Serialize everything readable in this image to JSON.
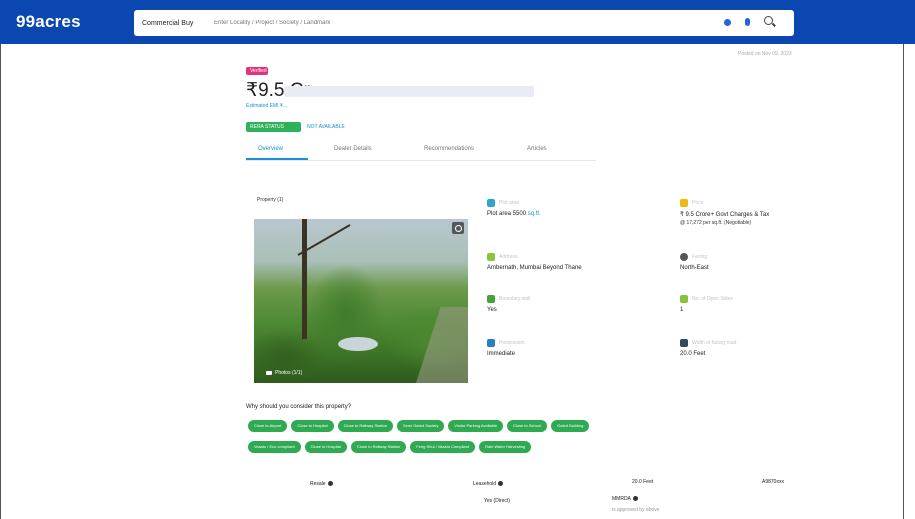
{
  "header": {
    "logo": "99acres",
    "search_category": "Commercial Buy",
    "search_placeholder": "Enter Locality / Project / Society / Landmark"
  },
  "posted": "Posted on Nov 09, 2023",
  "listing": {
    "badge": "Verified",
    "price": "₹9.5 Cr",
    "emi": "Estimated EMI ₹...",
    "rera_badge": "RERA STATUS",
    "rera_link": "NOT AVAILABLE"
  },
  "tabs": [
    "Overview",
    "Dealer Details",
    "Recommendations",
    "Articles"
  ],
  "photos": {
    "label": "Property (1)",
    "count": "Photos (1/1)"
  },
  "details": [
    {
      "icon": "area-icon",
      "color": "#2fa6c9",
      "label": "Plot area",
      "value": "Plot area 5500",
      "link": "sq.ft."
    },
    {
      "icon": "price-icon",
      "color": "#f2b70f",
      "label": "Price",
      "value": "₹ 9.5 Crore+ Govt Charges & Tax",
      "value2": "@ 17,272 per sq.ft. (Negotiable)"
    },
    {
      "icon": "address-icon",
      "color": "#8cc43c",
      "label": "Address",
      "value": "Ambernath, Mumbai Beyond Thane"
    },
    {
      "icon": "facing-icon",
      "color": "#555555",
      "label": "Facing",
      "value": "North-East"
    },
    {
      "icon": "boundary-icon",
      "color": "#45a23a",
      "label": "Boundary wall",
      "value": "Yes"
    },
    {
      "icon": "open-sides-icon",
      "color": "#87c23c",
      "label": "No. of Open Sides",
      "value": "1"
    },
    {
      "icon": "possession-icon",
      "color": "#2a7fc1",
      "label": "Possession",
      "value": "Immediate"
    },
    {
      "icon": "road-icon",
      "color": "#34495e",
      "label": "Width of facing road",
      "value": "20.0 Feet"
    }
  ],
  "why_heading": "Why should you consider this property?",
  "amenities_row1": [
    "Close to Airport",
    "Close to Hospital",
    "Close to Railway Station",
    "Semi Gated Society",
    "Visitor Parking Available",
    "Close to School",
    "Gated Building"
  ],
  "amenities_row2": [
    "Vaastu / Eco compliant",
    "Close to Hospital",
    "Close to Railway Station",
    "Feng Shui / Vaastu Compliant",
    "Rain Water Harvesting"
  ],
  "bottom": {
    "resale": "Resale",
    "leasehold": "Leasehold",
    "road_width": "20.0 Feet",
    "code": "A9870xxx",
    "yes_direct": "Yes (Direct)",
    "mmrda": "MMRDA",
    "approved_by": "is approved by above"
  }
}
